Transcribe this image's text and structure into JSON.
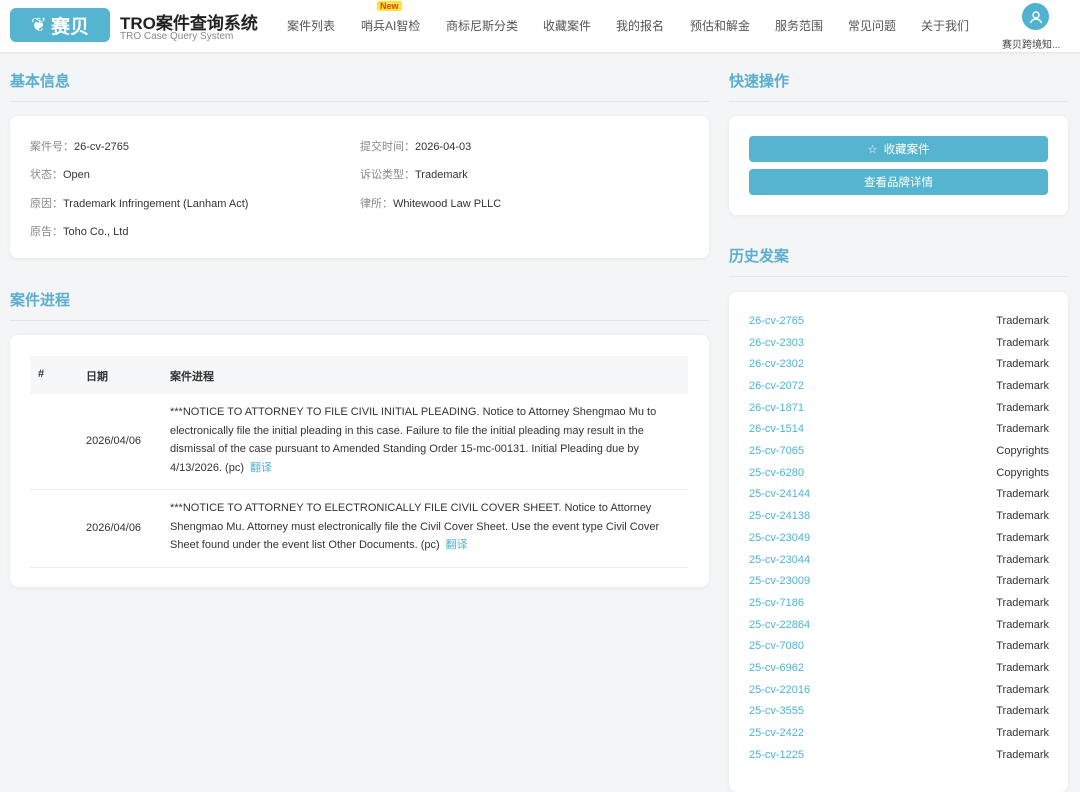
{
  "header": {
    "logo": "赛贝",
    "title": "TRO案件查询系统",
    "subtitle": "TRO Case Query System",
    "new_badge": "New",
    "nav": [
      "案件列表",
      "哨兵AI智检",
      "商标尼斯分类",
      "收藏案件",
      "我的报名",
      "预估和解金",
      "服务范围",
      "常见问题",
      "关于我们"
    ],
    "user": "赛贝跨境知..."
  },
  "basic": {
    "title": "基本信息",
    "fields": [
      {
        "k": "案件号：",
        "v": "26-cv-2765"
      },
      {
        "k": "提交时间：",
        "v": "2026-04-03"
      },
      {
        "k": "状态：",
        "v": "Open"
      },
      {
        "k": "诉讼类型：",
        "v": "Trademark"
      },
      {
        "k": "原因：",
        "v": "Trademark Infringement (Lanham Act)"
      },
      {
        "k": "律所：",
        "v": "Whitewood Law PLLC"
      },
      {
        "k": "原告：",
        "v": "Toho Co., Ltd"
      }
    ]
  },
  "progress": {
    "title": "案件进程",
    "headers": [
      "#",
      "日期",
      "案件进程"
    ],
    "translate": "翻译",
    "rows": [
      {
        "date": "2026/04/06",
        "text": "***NOTICE TO ATTORNEY TO FILE CIVIL INITIAL PLEADING. Notice to Attorney Shengmao Mu to electronically file the initial pleading in this case. Failure to file the initial pleading may result in the dismissal of the case pursuant to Amended Standing Order 15-mc-00131. Initial Pleading due by 4/13/2026. (pc)"
      },
      {
        "date": "2026/04/06",
        "text": "***NOTICE TO ATTORNEY TO ELECTRONICALLY FILE CIVIL COVER SHEET. Notice to Attorney Shengmao Mu. Attorney must electronically file the Civil Cover Sheet. Use the event type Civil Cover Sheet found under the event list Other Documents. (pc)"
      }
    ]
  },
  "quick": {
    "title": "快速操作",
    "favorite": "收藏案件",
    "brand": "查看品牌详情"
  },
  "history": {
    "title": "历史发案",
    "items": [
      [
        "26-cv-2765",
        "Trademark"
      ],
      [
        "26-cv-2303",
        "Trademark"
      ],
      [
        "26-cv-2302",
        "Trademark"
      ],
      [
        "26-cv-2072",
        "Trademark"
      ],
      [
        "26-cv-1871",
        "Trademark"
      ],
      [
        "26-cv-1514",
        "Trademark"
      ],
      [
        "25-cv-7065",
        "Copyrights"
      ],
      [
        "25-cv-6280",
        "Copyrights"
      ],
      [
        "25-cv-24144",
        "Trademark"
      ],
      [
        "25-cv-24138",
        "Trademark"
      ],
      [
        "25-cv-23049",
        "Trademark"
      ],
      [
        "25-cv-23044",
        "Trademark"
      ],
      [
        "25-cv-23009",
        "Trademark"
      ],
      [
        "25-cv-7186",
        "Trademark"
      ],
      [
        "25-cv-22864",
        "Trademark"
      ],
      [
        "25-cv-7080",
        "Trademark"
      ],
      [
        "25-cv-6962",
        "Trademark"
      ],
      [
        "25-cv-22016",
        "Trademark"
      ],
      [
        "25-cv-3555",
        "Trademark"
      ],
      [
        "25-cv-2422",
        "Trademark"
      ],
      [
        "25-cv-1225",
        "Trademark"
      ]
    ]
  }
}
